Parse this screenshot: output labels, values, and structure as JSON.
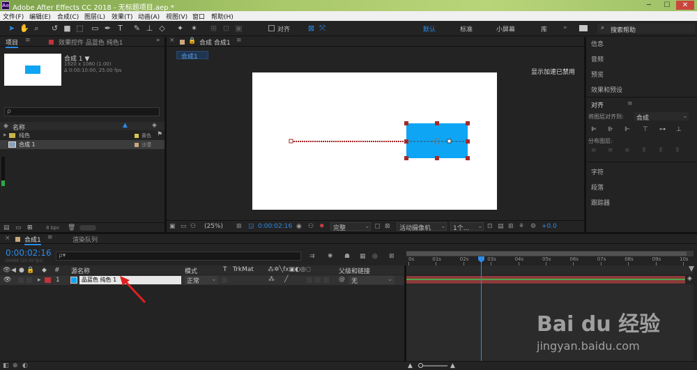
{
  "titlebar": {
    "app_logo": "Ae",
    "title": "Adobe After Effects CC 2018 - 无标题项目.aep *"
  },
  "menu": [
    "文件(F)",
    "编辑(E)",
    "合成(C)",
    "图层(L)",
    "效果(T)",
    "动画(A)",
    "视图(V)",
    "窗口",
    "帮助(H)"
  ],
  "toolbar": {
    "align_label": "对齐",
    "workspaces": [
      "默认",
      "标准",
      "小屏幕",
      "库"
    ],
    "search_placeholder": "搜索帮助"
  },
  "project": {
    "tab_project": "项目",
    "tab_effects": "效果控件 品蓝色 纯色1",
    "comp_name": "合成 1 ▼",
    "comp_res": "1920 x 1080 (1.00)",
    "comp_dur": "Δ 0:00:10:00, 25.00 fps",
    "col_name": "名称",
    "items": [
      {
        "name": "纯色",
        "label": "黄色"
      },
      {
        "name": "合成 1",
        "label": "沙漠"
      }
    ],
    "bpc": "8 bpc"
  },
  "viewer": {
    "tab_label": "合成 合成1",
    "breadcrumb": "合成1",
    "gpu_notice": "显示加速已禁用",
    "zoom": "(25%)",
    "timecode": "0:00:02:16",
    "quality": "完整",
    "camera": "活动摄像机",
    "views": "1个...",
    "exposure": "+0.0"
  },
  "right_panel": {
    "items": [
      "信息",
      "音频",
      "预览",
      "效果和预设"
    ],
    "align_title": "对齐",
    "align_to_label": "将图层对齐到:",
    "align_to_value": "合成",
    "distribute_label": "分布图层:",
    "items2": [
      "字符",
      "段落",
      "跟踪器"
    ]
  },
  "timeline": {
    "tab_comp": "合成1",
    "tab_render": "渲染队列",
    "timecode": "0:00:02:16",
    "timecode_sub": "00066 (25.00 fps)",
    "search_placeholder": "ρ▾",
    "col_source": "源名称",
    "col_mode": "模式",
    "col_t": "T",
    "col_trkmat": "TrkMat",
    "col_parent": "父级和链接",
    "layer": {
      "num": "1",
      "name": "品蓝色 纯色 1",
      "mode": "正常",
      "parent": "无"
    },
    "ticks": [
      "0s",
      "01s",
      "02s",
      "03s",
      "04s",
      "05s",
      "06s",
      "07s",
      "08s",
      "09s",
      "10s"
    ],
    "playhead_time_s": 2.64
  },
  "watermark": {
    "brand": "Bai du 经验",
    "url": "jingyan.baidu.com"
  },
  "colors": {
    "accent": "#2d8ceb",
    "layer_bar": "#8b3a3a",
    "solid": "#0ea5f5",
    "timecode": "#2d8ceb"
  }
}
